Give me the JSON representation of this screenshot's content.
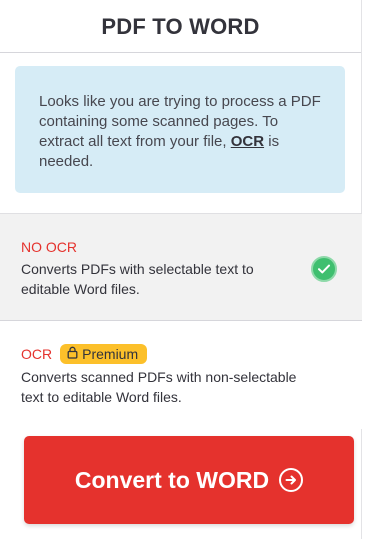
{
  "panel": {
    "title": "PDF TO WORD"
  },
  "notice": {
    "text_before": "Looks like you are trying to process a PDF containing some scanned pages. To extract all text from your file, ",
    "ocr_link": "OCR",
    "text_after": " is needed.",
    "background": "#d6ecf6"
  },
  "options": {
    "no_ocr": {
      "label": "NO OCR",
      "description": "Converts PDFs with selectable text to editable Word files.",
      "selected": true,
      "check_icon": "check-circle-icon"
    },
    "ocr": {
      "label": "OCR",
      "badge": "Premium",
      "badge_icon": "lock-icon",
      "description": "Converts scanned PDFs with non-selectable text to editable Word files.",
      "selected": false
    }
  },
  "convert_button": {
    "label": "Convert to WORD",
    "icon": "arrow-right-circle-icon"
  },
  "colors": {
    "accent_red": "#e5322d",
    "selected_green": "#3fbf6f",
    "premium_yellow": "#fcc02a"
  }
}
